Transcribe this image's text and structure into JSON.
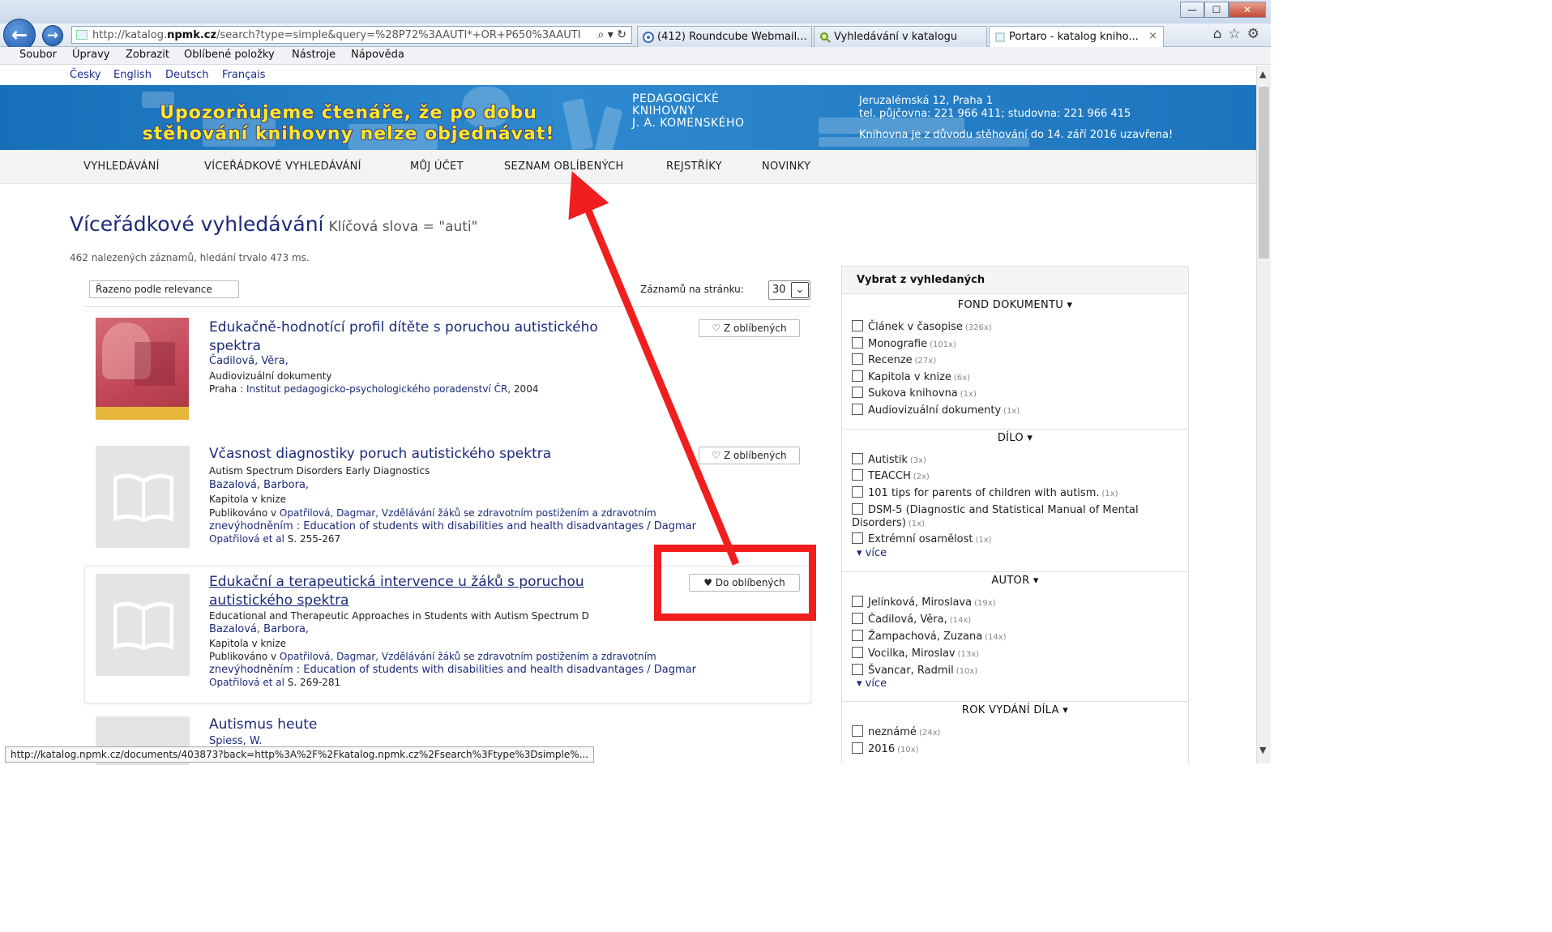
{
  "browser": {
    "address": {
      "prefix": "http://katalog.",
      "host": "npmk.cz",
      "rest": "/search?type=simple&query=%28P72%3AAUTI*+OR+P650%3AAUTI",
      "controls": "⌕ ▾ ↻"
    },
    "tabs": [
      {
        "label": "(412) Roundcube Webmail..."
      },
      {
        "label": "Vyhledávání v katalogu"
      },
      {
        "label": "Portaro - katalog kniho...",
        "close": "×"
      }
    ],
    "toolbar_icons": "⌂☆⚙",
    "window_buttons": {
      "minimize": "—",
      "maximize": "☐",
      "close": "✕"
    },
    "menu": [
      "Soubor",
      "Úpravy",
      "Zobrazit",
      "Oblíbené položky",
      "Nástroje",
      "Nápověda"
    ],
    "status_url": "http://katalog.npmk.cz/documents/403873?back=http%3A%2F%2Fkatalog.npmk.cz%2Fsearch%3Ftype%3Dsimple%..."
  },
  "languages": [
    "Česky",
    "English",
    "Deutsch",
    "Français"
  ],
  "banner": {
    "warning_line1": "Upozorňujeme čtenáře, že po dobu",
    "warning_line2": "stěhování knihovny nelze objednávat!",
    "library_name": [
      "PEDAGOGICKÉ",
      "KNIHOVNY",
      "J. A. KOMENSKÉHO"
    ],
    "address_line1": "Jeruzalémská 12, Praha 1",
    "address_line2": "tel. půjčovna: 221 966 411; studovna: 221 966 415",
    "closed_notice": "Knihovna je z důvodu stěhování do 14. září 2016 uzavřena!"
  },
  "nav": [
    "VYHLEDÁVÁNÍ",
    "VÍCEŘÁDKOVÉ VYHLEDÁVÁNÍ",
    "MŮJ ÚČET",
    "SEZNAM OBLÍBENÝCH",
    "REJSTŘÍKY",
    "NOVINKY"
  ],
  "page": {
    "title": "Víceřádkové vyhledávání",
    "subtitle": "Klíčová slova = \"auti\"",
    "result_count": "462 nalezených záznamů, hledání trvalo 473 ms.",
    "sort_label": "Řazeno podle relevance",
    "per_page_label": "Záznamů na stránku:",
    "per_page_value": "30",
    "per_page_arrow": "⌄"
  },
  "records": [
    {
      "title_l1": "Edukačně-hodnotící profil dítěte s poruchou autistického",
      "title_l2": "spektra",
      "author": "Čadilová, Věra,",
      "type": "Audiovizuální dokumenty",
      "place": "Praha : ",
      "publisher": "Institut pedagogicko-psychologického poradenství ČR",
      "year": ", 2004",
      "fav_label": "♡ Z oblíbených"
    },
    {
      "title_l1": "Včasnost diagnostiky poruch autistického spektra",
      "subtitle": "Autism Spectrum Disorders Early Diagnostics",
      "author": "Bazalová, Barbora,",
      "type": "Kapitola v knize",
      "pub_prefix": "Publikováno v ",
      "pub_l1": "Opatřilová, Dagmar, Vzdělávání žáků se zdravotním postižením a zdravotním",
      "pub_l2": "znevýhodněním : Education of students with disabilities and health disadvantages / Dagmar",
      "pub_l3": "Opatřilová et al",
      "pages": " S. 255-267",
      "fav_label": "♡ Z oblíbených"
    },
    {
      "title_l1": "Edukační a terapeutická intervence u žáků s poruchou",
      "title_l2": "autistického spektra",
      "subtitle": "Educational and Therapeutic Approaches in Students with Autism Spectrum D",
      "author": "Bazalová, Barbora,",
      "type": "Kapitola v knize",
      "pub_prefix": "Publikováno v ",
      "pub_l1": "Opatřilová, Dagmar, Vzdělávání žáků se zdravotním postižením a zdravotním",
      "pub_l2": "znevýhodněním : Education of students with disabilities and health disadvantages / Dagmar",
      "pub_l3": "Opatřilová et al",
      "pages": " S. 269-281",
      "fav_label": "♥ Do oblíbených"
    },
    {
      "title_l1": "Autismus heute",
      "author": "Spiess, W."
    }
  ],
  "sidebar": {
    "heading": "Vybrat z vyhledaných",
    "fond": {
      "heading": "FOND DOKUMENTU ▾",
      "items": [
        {
          "label": "Článek v časopise",
          "count": "(326x)"
        },
        {
          "label": "Monografie",
          "count": "(101x)"
        },
        {
          "label": "Recenze",
          "count": "(27x)"
        },
        {
          "label": "Kapitola v knize",
          "count": "(6x)"
        },
        {
          "label": "Sukova knihovna",
          "count": "(1x)"
        },
        {
          "label": "Audiovizuální dokumenty",
          "count": "(1x)"
        }
      ]
    },
    "dilo": {
      "heading": "DÍLO ▾",
      "items": [
        {
          "label": "Autistik",
          "count": "(3x)"
        },
        {
          "label": "TEACCH",
          "count": "(2x)"
        },
        {
          "label": "101 tips for parents of children with autism.",
          "count": "(1x)"
        },
        {
          "label": "DSM-5 (Diagnostic and Statistical Manual of Mental Disorders)",
          "count": "(1x)"
        },
        {
          "label": "Extrémní osamělost",
          "count": "(1x)"
        }
      ],
      "more": "▾ více"
    },
    "autor": {
      "heading": "AUTOR ▾",
      "items": [
        {
          "label": "Jelínková, Miroslava",
          "count": "(19x)"
        },
        {
          "label": "Čadilová, Věra,",
          "count": "(14x)"
        },
        {
          "label": "Žampachová, Zuzana",
          "count": "(14x)"
        },
        {
          "label": "Vocilka, Miroslav",
          "count": "(13x)"
        },
        {
          "label": "Švancar, Radmil",
          "count": "(10x)"
        }
      ],
      "more": "▾ více"
    },
    "rok": {
      "heading": "ROK VYDÁNÍ DÍLA ▾",
      "items": [
        {
          "label": "neznámé",
          "count": "(24x)"
        },
        {
          "label": "2016",
          "count": "(10x)"
        }
      ]
    }
  },
  "scroll": {
    "up": "▲",
    "down": "▼"
  }
}
